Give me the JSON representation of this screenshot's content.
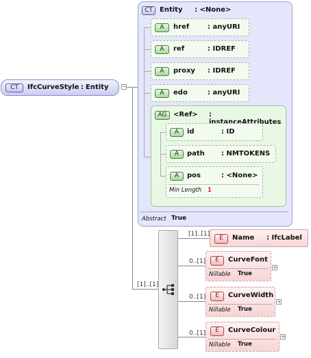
{
  "root": {
    "badge": "CT",
    "name": "IfcCurveStyle",
    "sep": ":",
    "type": "Entity"
  },
  "base": {
    "badge": "CT",
    "name": "Entity",
    "type": ": <None>",
    "attributes": [
      {
        "badge": "A",
        "name": "href",
        "type": ": anyURI"
      },
      {
        "badge": "A",
        "name": "ref",
        "type": ": IDREF"
      },
      {
        "badge": "A",
        "name": "proxy",
        "type": ": IDREF"
      },
      {
        "badge": "A",
        "name": "edo",
        "type": ": anyURI"
      }
    ],
    "group": {
      "badge": "AG",
      "name": "<Ref>",
      "type": ": instanceAttributes",
      "attributes": [
        {
          "badge": "A",
          "name": "id",
          "type": ": ID"
        },
        {
          "badge": "A",
          "name": "path",
          "type": ": NMTOKENS"
        },
        {
          "badge": "A",
          "name": "pos",
          "type": ": <None>",
          "facet_label": "Min Length",
          "facet_value": "1"
        }
      ]
    },
    "abstract_label": "Abstract",
    "abstract_value": "True"
  },
  "sequence": {
    "cardinality": "[1]..[1]"
  },
  "elements": [
    {
      "badge": "E",
      "name": "Name",
      "type": ": IfcLabel",
      "cardinality": "[1]..[1]"
    },
    {
      "badge": "E",
      "name": "CurveFont",
      "cardinality": "0..[1]",
      "nillable_label": "Nillable",
      "nillable_value": "True"
    },
    {
      "badge": "E",
      "name": "CurveWidth",
      "cardinality": "0..[1]",
      "nillable_label": "Nillable",
      "nillable_value": "True"
    },
    {
      "badge": "E",
      "name": "CurveColour",
      "cardinality": "0..[1]",
      "nillable_label": "Nillable",
      "nillable_value": "True"
    }
  ],
  "colors": {
    "complex_bg": "#e4e6fb",
    "group_bg": "#e9f8e4",
    "element_bg": "#f8dada"
  }
}
